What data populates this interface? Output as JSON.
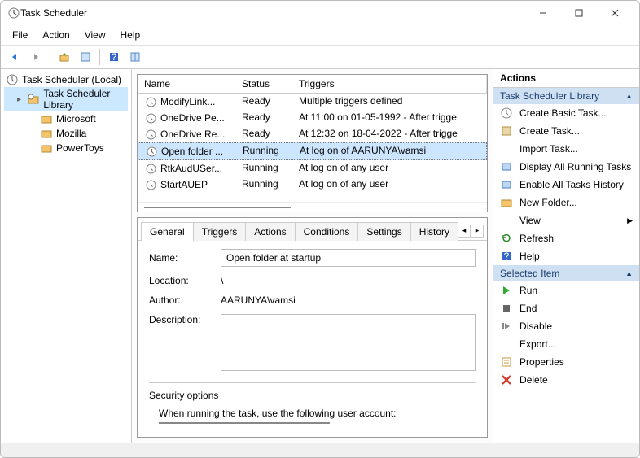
{
  "window": {
    "title": "Task Scheduler"
  },
  "menus": {
    "file": "File",
    "action": "Action",
    "view": "View",
    "help": "Help"
  },
  "tree": {
    "root": "Task Scheduler (Local)",
    "library": "Task Scheduler Library",
    "items": [
      "Microsoft",
      "Mozilla",
      "PowerToys"
    ]
  },
  "columns": {
    "name": "Name",
    "status": "Status",
    "triggers": "Triggers"
  },
  "tasks": [
    {
      "name": "ModifyLink...",
      "status": "Ready",
      "trigger": "Multiple triggers defined"
    },
    {
      "name": "OneDrive Pe...",
      "status": "Ready",
      "trigger": "At 11:00 on 01-05-1992 - After trigge"
    },
    {
      "name": "OneDrive Re...",
      "status": "Ready",
      "trigger": "At 12:32 on 18-04-2022 - After trigge"
    },
    {
      "name": "Open folder ...",
      "status": "Running",
      "trigger": "At log on of AARUNYA\\vamsi",
      "selected": true
    },
    {
      "name": "RtkAudUSer...",
      "status": "Running",
      "trigger": "At log on of any user"
    },
    {
      "name": "StartAUEP",
      "status": "Running",
      "trigger": "At log on of any user"
    }
  ],
  "tabs": {
    "general": "General",
    "triggers": "Triggers",
    "actions": "Actions",
    "conditions": "Conditions",
    "settings": "Settings",
    "history": "History"
  },
  "detail": {
    "name_label": "Name:",
    "name_value": "Open folder at startup",
    "location_label": "Location:",
    "location_value": "\\",
    "author_label": "Author:",
    "author_value": "AARUNYA\\vamsi",
    "description_label": "Description:",
    "description_value": "",
    "security_title": "Security options",
    "security_text": "When running the task, use the following user account:"
  },
  "actions": {
    "title": "Actions",
    "section1": "Task Scheduler Library",
    "library": {
      "create_basic": "Create Basic Task...",
      "create": "Create Task...",
      "import": "Import Task...",
      "display_running": "Display All Running Tasks",
      "enable_history": "Enable All Tasks History",
      "new_folder": "New Folder...",
      "view": "View",
      "refresh": "Refresh",
      "help": "Help"
    },
    "section2": "Selected Item",
    "item": {
      "run": "Run",
      "end": "End",
      "disable": "Disable",
      "export": "Export...",
      "properties": "Properties",
      "delete": "Delete"
    }
  }
}
